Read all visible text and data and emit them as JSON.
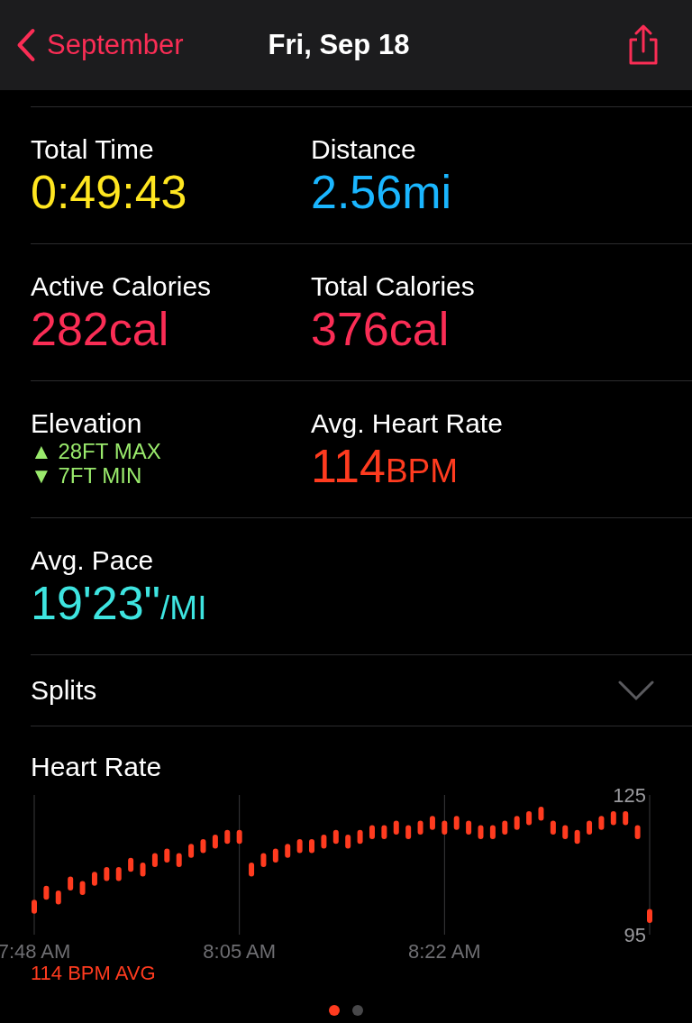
{
  "nav": {
    "back": "September",
    "title": "Fri, Sep 18"
  },
  "metric_rows": [
    [
      {
        "kind": "value",
        "label": "Total Time",
        "value": "0:49:43",
        "color": "#ffe620"
      },
      {
        "kind": "value",
        "label": "Distance",
        "value": "2.56mi",
        "color": "#1ab6ff"
      }
    ],
    [
      {
        "kind": "value",
        "label": "Active Calories",
        "value": "282cal",
        "color": "#fa2d55"
      },
      {
        "kind": "value",
        "label": "Total Calories",
        "value": "376cal",
        "color": "#fa2d55"
      }
    ],
    [
      {
        "kind": "range",
        "label": "Elevation",
        "color": "#9aea6c",
        "lines": [
          {
            "arrow": "▲",
            "text": "28FT MAX"
          },
          {
            "arrow": "▼",
            "text": "7FT MIN"
          }
        ]
      },
      {
        "kind": "value",
        "label": "Avg. Heart Rate",
        "value": "114",
        "unit": "BPM",
        "color": "#ff3b1f"
      }
    ],
    [
      {
        "kind": "value",
        "label": "Avg. Pace",
        "value": "19'23\"",
        "unit": "/MI",
        "color": "#3ee4e0"
      }
    ]
  ],
  "splits": {
    "label": "Splits",
    "expanded": false
  },
  "heart_rate": {
    "title": "Heart Rate",
    "average": "114 BPM AVG",
    "chart_data": {
      "type": "scatter",
      "ylim": [
        95,
        125
      ],
      "yticks": [
        95,
        125
      ],
      "xlim": [
        468,
        519
      ],
      "xticks": [
        {
          "value": 468,
          "label": "7:48 AM"
        },
        {
          "value": 485,
          "label": "8:05 AM"
        },
        {
          "value": 502,
          "label": "8:22 AM"
        }
      ],
      "x": [
        468,
        469,
        470,
        471,
        472,
        473,
        474,
        475,
        476,
        477,
        478,
        479,
        480,
        481,
        482,
        483,
        484,
        485,
        486,
        487,
        488,
        489,
        490,
        491,
        492,
        493,
        494,
        495,
        496,
        497,
        498,
        499,
        500,
        501,
        502,
        503,
        504,
        505,
        506,
        507,
        508,
        509,
        510,
        511,
        512,
        513,
        514,
        515,
        516,
        517,
        518,
        519
      ],
      "series": [
        {
          "color": "#ff3b1f",
          "values": [
            101,
            104,
            103,
            106,
            105,
            107,
            108,
            108,
            110,
            109,
            111,
            112,
            111,
            113,
            114,
            115,
            116,
            116,
            109,
            111,
            112,
            113,
            114,
            114,
            115,
            116,
            115,
            116,
            117,
            117,
            118,
            117,
            118,
            119,
            118,
            119,
            118,
            117,
            117,
            118,
            119,
            120,
            121,
            118,
            117,
            116,
            118,
            119,
            120,
            120,
            117,
            99
          ]
        }
      ]
    }
  },
  "page_dots": [
    {
      "selected": true
    },
    {
      "selected": false
    }
  ]
}
